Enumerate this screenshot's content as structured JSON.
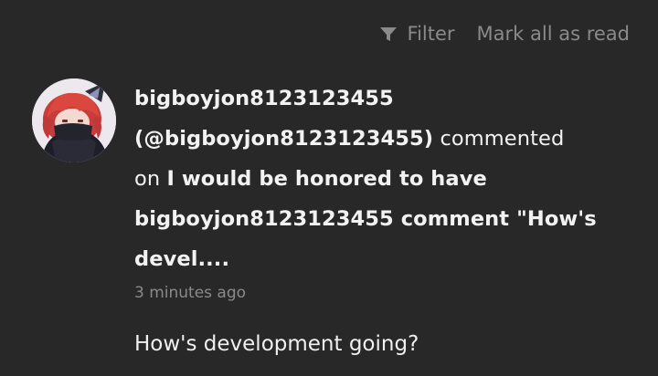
{
  "toolbar": {
    "filter_label": "Filter",
    "mark_all_label": "Mark all as read",
    "text_color": "#8a8a8a"
  },
  "notification": {
    "username": "bigboyjon8123123455",
    "handle": "(@bigboyjon8123123455)",
    "action_text": "commented",
    "preposition": "on",
    "post_title": "I would be honored to have bigboyjon8123123455 comment \"How's devel....",
    "timestamp": "3 minutes ago",
    "comment_text": "How's development going?",
    "avatar_icon": "avatar-red-haired-character-icon"
  },
  "theme": {
    "background": "#282828",
    "primary_text": "#f2f2f2",
    "secondary_text": "#8a8a8a"
  }
}
